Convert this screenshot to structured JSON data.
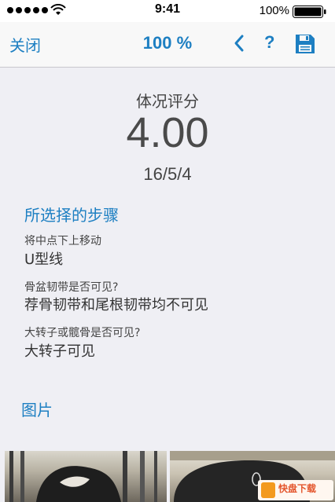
{
  "status_bar": {
    "time": "9:41",
    "battery": "100%"
  },
  "nav": {
    "close_label": "关闭",
    "zoom": "100 %",
    "help_label": "?"
  },
  "score": {
    "title": "体况评分",
    "value": "4.00",
    "date": "16/5/4"
  },
  "steps": {
    "title": "所选择的步骤",
    "items": [
      {
        "question": "将中点下上移动",
        "answer": "U型线"
      },
      {
        "question": "骨盆韧带是否可见?",
        "answer": "荐骨韧带和尾根韧带均不可见"
      },
      {
        "question": "大转子或髋骨是否可见?",
        "answer": "大转子可见"
      }
    ]
  },
  "photos": {
    "title": "图片"
  },
  "watermark": {
    "text": "快盘下载"
  },
  "colors": {
    "accent": "#1d7fc2",
    "background": "#efeff4"
  }
}
